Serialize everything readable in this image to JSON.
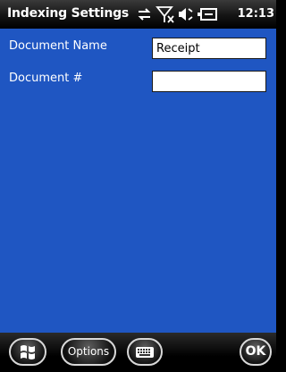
{
  "titlebar": {
    "title": "Indexing Settings",
    "status": {
      "clock": "12:13",
      "icons": [
        "connectivity-icon",
        "no-signal-icon",
        "volume-icon",
        "battery-icon"
      ]
    }
  },
  "form": {
    "document_name": {
      "label": "Document Name",
      "value": "Receipt",
      "placeholder": ""
    },
    "document_number": {
      "label": "Document #",
      "value": "",
      "placeholder": ""
    }
  },
  "softkeys": {
    "start_icon": "windows-start-icon",
    "options_label": "Options",
    "keyboard_icon": "keyboard-icon",
    "ok_label": "OK"
  },
  "colors": {
    "background": "#1f56c2",
    "titlebar": "#000000",
    "text": "#ffffff"
  }
}
